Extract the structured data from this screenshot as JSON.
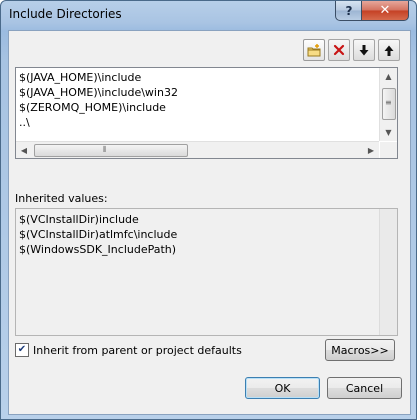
{
  "window": {
    "title": "Include Directories"
  },
  "titlebar": {
    "help_label": "?",
    "close_label": "✕"
  },
  "toolbar": {
    "buttons": [
      {
        "name": "new-line",
        "icon": "new-folder-icon"
      },
      {
        "name": "delete",
        "icon": "delete-x-icon"
      },
      {
        "name": "move-down",
        "icon": "arrow-down-icon"
      },
      {
        "name": "move-up",
        "icon": "arrow-up-icon"
      }
    ]
  },
  "directories": {
    "items": [
      "$(JAVA_HOME)\\include",
      "$(JAVA_HOME)\\include\\win32",
      "$(ZEROMQ_HOME)\\include",
      "..\\"
    ]
  },
  "inherited": {
    "label": "Inherited values:",
    "items": [
      "$(VCInstallDir)include",
      "$(VCInstallDir)atlmfc\\include",
      "$(WindowsSDK_IncludePath)"
    ]
  },
  "inherit_checkbox": {
    "label": "Inherit from parent or project defaults",
    "checked": true
  },
  "buttons": {
    "macros": "Macros>>",
    "ok": "OK",
    "cancel": "Cancel"
  },
  "colors": {
    "title_gradient": "#a9c4e3",
    "close_red": "#c44024",
    "dialog_bg": "#f0f0f0"
  }
}
